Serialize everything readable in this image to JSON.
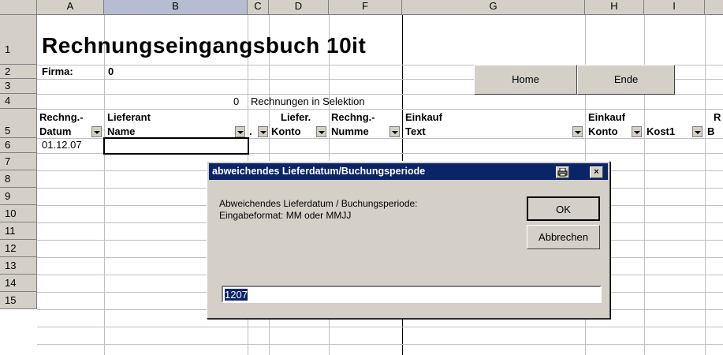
{
  "columns": [
    "A",
    "B",
    "C",
    "D",
    "F",
    "G",
    "H",
    "I"
  ],
  "selected_column": "B",
  "rows": [
    "1",
    "2",
    "3",
    "4",
    "5",
    "6",
    "7",
    "8",
    "9",
    "10",
    "11",
    "12",
    "13",
    "14",
    "15"
  ],
  "sheet": {
    "title": "Rechnungseingangsbuch 10it",
    "firma_label": "Firma:",
    "firma_value": "0",
    "selection_count": "0",
    "selection_text": "Rechnungen in Selektion",
    "headers_top": {
      "a": "Rechng.-",
      "b": "Lieferant",
      "d": "Liefer.",
      "f": "Rechng.-",
      "g": "Einkauf",
      "h": "Einkauf",
      "r": "R"
    },
    "headers_bottom": {
      "a": "Datum",
      "b": "Name",
      "c": ".",
      "d": "Konto",
      "f": "Numme",
      "g": "Text",
      "h": "Konto",
      "i": "Kost1",
      "j": "B"
    },
    "a6": "01.12.07"
  },
  "buttons": {
    "home": "Home",
    "ende": "Ende"
  },
  "dialog": {
    "title": "abweichendes Lieferdatum/Buchungsperiode",
    "message_line1": "Abweichendes Lieferdatum / Buchungsperiode:",
    "message_line2": "Eingabeformat: MM oder MMJJ",
    "ok": "OK",
    "cancel": "Abbrechen",
    "input_value": "1207",
    "print_icon": "printer-icon",
    "close_icon": "close-icon",
    "close_glyph": "×"
  },
  "colors": {
    "title_bar": "#0a246a",
    "face": "#d4d0c8",
    "selected_header": "#b6bdd2"
  }
}
